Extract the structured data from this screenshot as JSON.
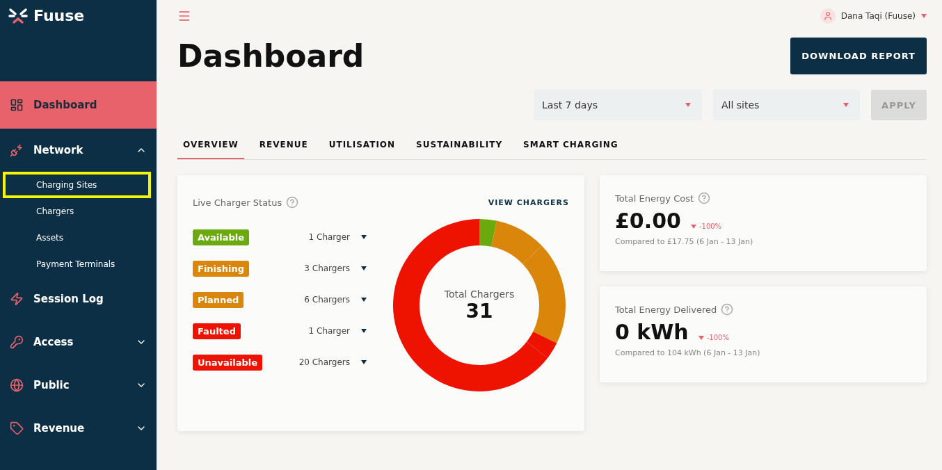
{
  "brand": {
    "name": "Fuuse"
  },
  "sidebar": {
    "items": [
      {
        "label": "Dashboard",
        "selected": true
      },
      {
        "label": "Network",
        "selected": false,
        "expanded": true,
        "children": [
          {
            "label": "Charging Sites",
            "highlighted": true
          },
          {
            "label": "Chargers",
            "highlighted": false
          },
          {
            "label": "Assets",
            "highlighted": false
          },
          {
            "label": "Payment Terminals",
            "highlighted": false
          }
        ]
      },
      {
        "label": "Session Log",
        "selected": false
      },
      {
        "label": "Access",
        "selected": false,
        "expanded": false
      },
      {
        "label": "Public",
        "selected": false,
        "expanded": false
      },
      {
        "label": "Revenue",
        "selected": false,
        "expanded": false
      }
    ]
  },
  "header": {
    "user": "Dana Taqi (Fuuse)"
  },
  "page": {
    "title": "Dashboard",
    "download_button": "DOWNLOAD REPORT"
  },
  "filters": {
    "period": "Last 7 days",
    "sites": "All sites",
    "apply": {
      "label": "APPLY",
      "disabled": true
    }
  },
  "tabs": [
    {
      "label": "OVERVIEW",
      "selected": true
    },
    {
      "label": "REVENUE",
      "selected": false
    },
    {
      "label": "UTILISATION",
      "selected": false
    },
    {
      "label": "SUSTAINABILITY",
      "selected": false
    },
    {
      "label": "SMART CHARGING",
      "selected": false
    }
  ],
  "charger_status": {
    "title": "Live Charger Status",
    "link": "VIEW CHARGERS",
    "center_label": "Total Chargers",
    "total": "31",
    "statuses": [
      {
        "count": "1 Charger",
        "color": "#6aaa0c"
      },
      {
        "count": "3 Chargers",
        "color": "#d9860a"
      },
      {
        "count": "6 Chargers",
        "color": "#d9860a"
      },
      {
        "count": "1 Charger",
        "color": "#ee1200"
      },
      {
        "count": "20 Chargers",
        "color": "#ee1200"
      }
    ],
    "chart_data": {
      "type": "donut",
      "categories": [
        "Available",
        "Finishing",
        "Planned",
        "Faulted",
        "Unavailable"
      ],
      "values": [
        3.23,
        9.68,
        19.35,
        3.22,
        64.52
      ]
    }
  },
  "kpis": [
    {
      "title": "Total Energy Cost",
      "value": "£0.00",
      "change": "-100%",
      "comparison": "Compared to £17.75 (6 Jan - 13 Jan)"
    },
    {
      "title": "Total Energy Delivered",
      "value": "0 kWh",
      "change": "-100%",
      "comparison": "Compared to 104 kWh (6 Jan - 13 Jan)"
    }
  ]
}
